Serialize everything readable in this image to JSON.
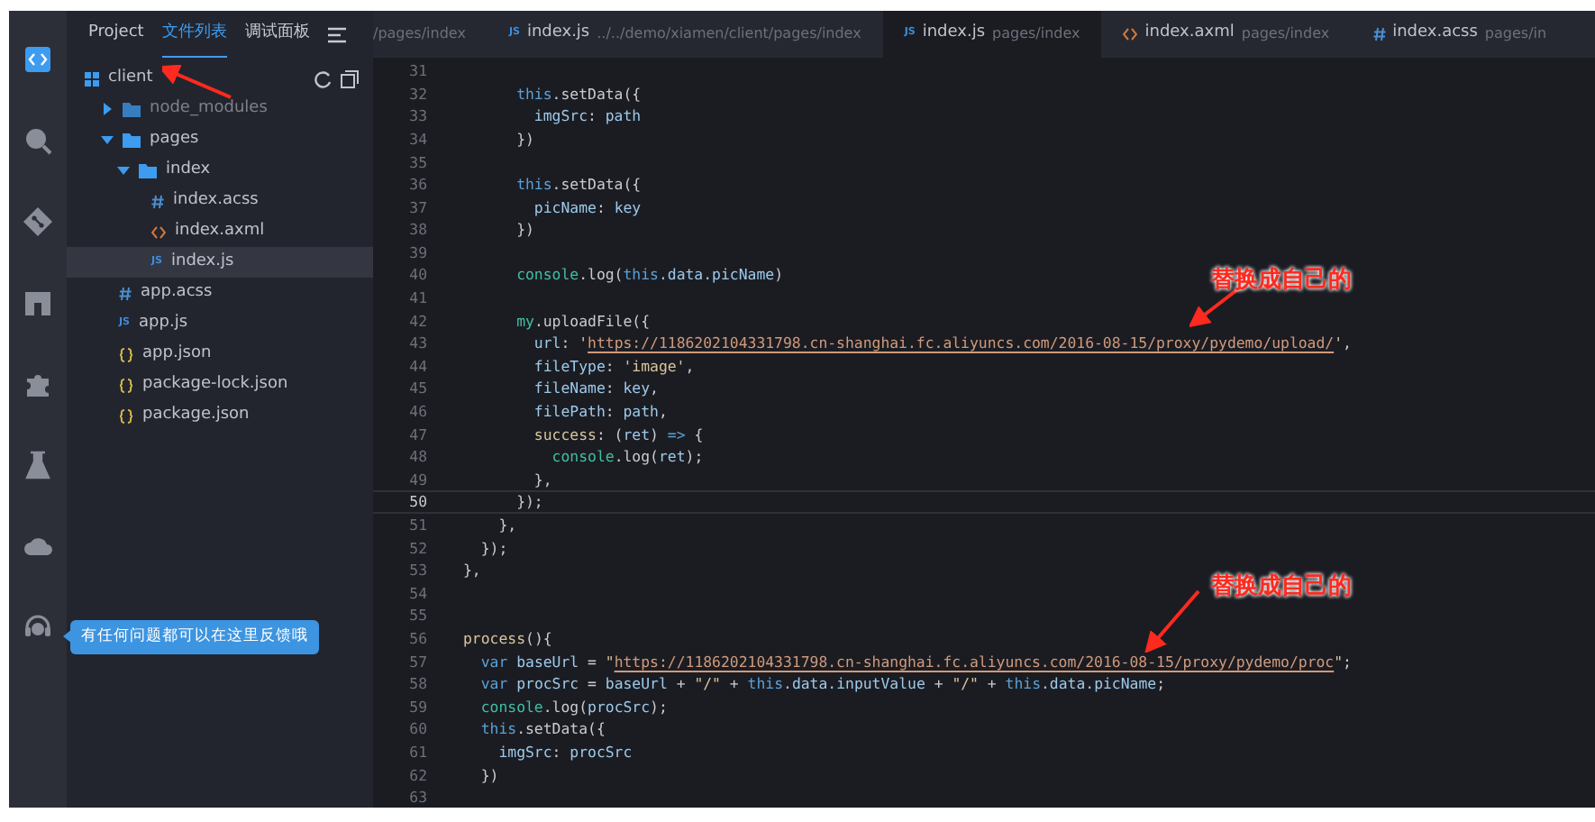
{
  "activity_bar": {
    "items": [
      {
        "kind": "code",
        "selected": true
      },
      {
        "kind": "search",
        "selected": false
      },
      {
        "kind": "git",
        "selected": false
      },
      {
        "kind": "store",
        "selected": false
      },
      {
        "kind": "plugin",
        "selected": false
      },
      {
        "kind": "flask",
        "selected": false
      },
      {
        "kind": "cloud",
        "selected": false
      },
      {
        "kind": "headset",
        "selected": false
      }
    ]
  },
  "sidebar": {
    "tabs": [
      {
        "label": "Project",
        "selected": false
      },
      {
        "label": "文件列表",
        "selected": true
      },
      {
        "label": "调试面板",
        "selected": false
      }
    ],
    "root": "client",
    "tree": [
      {
        "name": "node_modules",
        "kind": "folder",
        "expanded": false,
        "selected": false,
        "dim": true
      },
      {
        "name": "pages",
        "kind": "folder",
        "expanded": true,
        "selected": false,
        "dim": false,
        "children": [
          {
            "name": "index",
            "kind": "folder",
            "expanded": true,
            "selected": false,
            "dim": false,
            "children": [
              {
                "name": "index.acss",
                "kind": "acss",
                "selected": false,
                "dim": false
              },
              {
                "name": "index.axml",
                "kind": "axml",
                "selected": false,
                "dim": false
              },
              {
                "name": "index.js",
                "kind": "js",
                "icon_text": "JS",
                "selected": true,
                "dim": false
              }
            ]
          }
        ]
      },
      {
        "name": "app.acss",
        "kind": "acss",
        "selected": false,
        "dim": false
      },
      {
        "name": "app.js",
        "kind": "js",
        "icon_text": "JS",
        "selected": false,
        "dim": false
      },
      {
        "name": "app.json",
        "kind": "json",
        "selected": false,
        "dim": false
      },
      {
        "name": "package-lock.json",
        "kind": "json",
        "selected": false,
        "dim": false
      },
      {
        "name": "package.json",
        "kind": "json",
        "selected": false,
        "dim": false
      }
    ]
  },
  "tooltip": "有任何问题都可以在这里反馈哦",
  "editor_tabs": [
    {
      "kind": "none",
      "path": "/pages/index",
      "selected": false
    },
    {
      "kind": "js",
      "icon_text": "JS",
      "name": "index.js",
      "path": "../../demo/xiamen/client/pages/index",
      "selected": false
    },
    {
      "kind": "js",
      "icon_text": "JS",
      "name": "index.js",
      "path": "pages/index",
      "selected": true
    },
    {
      "kind": "axml",
      "name": "index.axml",
      "path": "pages/index",
      "selected": false
    },
    {
      "kind": "acss",
      "name": "index.acss",
      "path": "pages/in",
      "selected": false
    }
  ],
  "code": [
    {
      "number": "31",
      "current": false
    },
    {
      "number": "32",
      "current": false,
      "tokens": [
        {
          "kind": "this",
          "text": "      this"
        },
        {
          "kind": "plain",
          "text": ".setData({"
        }
      ]
    },
    {
      "number": "33",
      "current": false,
      "tokens": [
        {
          "kind": "prop",
          "text": "        imgSrc"
        },
        {
          "kind": "plain",
          "text": ": "
        },
        {
          "kind": "prop",
          "text": "path"
        }
      ]
    },
    {
      "number": "34",
      "current": false,
      "tokens": [
        {
          "kind": "plain",
          "text": "      })"
        }
      ]
    },
    {
      "number": "35",
      "current": false
    },
    {
      "number": "36",
      "current": false,
      "tokens": [
        {
          "kind": "this",
          "text": "      this"
        },
        {
          "kind": "plain",
          "text": ".setData({"
        }
      ]
    },
    {
      "number": "37",
      "current": false,
      "tokens": [
        {
          "kind": "prop",
          "text": "        picName"
        },
        {
          "kind": "plain",
          "text": ": "
        },
        {
          "kind": "prop",
          "text": "key"
        }
      ]
    },
    {
      "number": "38",
      "current": false,
      "tokens": [
        {
          "kind": "plain",
          "text": "      })"
        }
      ]
    },
    {
      "number": "39",
      "current": false
    },
    {
      "number": "40",
      "current": false,
      "tokens": [
        {
          "kind": "func",
          "text": "      console"
        },
        {
          "kind": "plain",
          "text": ".log("
        },
        {
          "kind": "this",
          "text": "this"
        },
        {
          "kind": "prop",
          "text": ".data.picName"
        },
        {
          "kind": "plain",
          "text": ")"
        }
      ]
    },
    {
      "number": "41",
      "current": false
    },
    {
      "number": "42",
      "current": false,
      "tokens": [
        {
          "kind": "func",
          "text": "      my"
        },
        {
          "kind": "plain",
          "text": ".uploadFile({"
        }
      ]
    },
    {
      "number": "43",
      "current": false,
      "tokens": [
        {
          "kind": "prop",
          "text": "        url"
        },
        {
          "kind": "plain",
          "text": ": "
        },
        {
          "kind": "string",
          "text": "'"
        },
        {
          "kind": "url",
          "text": "https://1186202104331798.cn-shanghai.fc.aliyuncs.com/2016-08-15/proxy/pydemo/upload/"
        },
        {
          "kind": "string",
          "text": "'"
        },
        {
          "kind": "plain",
          "text": ","
        }
      ]
    },
    {
      "number": "44",
      "current": false,
      "tokens": [
        {
          "kind": "prop",
          "text": "        fileType"
        },
        {
          "kind": "plain",
          "text": ": "
        },
        {
          "kind": "string",
          "text": "'image'"
        },
        {
          "kind": "plain",
          "text": ","
        }
      ]
    },
    {
      "number": "45",
      "current": false,
      "tokens": [
        {
          "kind": "prop",
          "text": "        fileName"
        },
        {
          "kind": "plain",
          "text": ": "
        },
        {
          "kind": "prop",
          "text": "key"
        },
        {
          "kind": "plain",
          "text": ","
        }
      ]
    },
    {
      "number": "46",
      "current": false,
      "tokens": [
        {
          "kind": "prop",
          "text": "        filePath"
        },
        {
          "kind": "plain",
          "text": ": "
        },
        {
          "kind": "prop",
          "text": "path"
        },
        {
          "kind": "plain",
          "text": ","
        }
      ]
    },
    {
      "number": "47",
      "current": false,
      "tokens": [
        {
          "kind": "string",
          "text": "        success"
        },
        {
          "kind": "plain",
          "text": ": ("
        },
        {
          "kind": "prop",
          "text": "ret"
        },
        {
          "kind": "plain",
          "text": ") "
        },
        {
          "kind": "keyword",
          "text": "=>"
        },
        {
          "kind": "plain",
          "text": " {"
        }
      ]
    },
    {
      "number": "48",
      "current": false,
      "tokens": [
        {
          "kind": "func",
          "text": "          console"
        },
        {
          "kind": "plain",
          "text": ".log("
        },
        {
          "kind": "prop",
          "text": "ret"
        },
        {
          "kind": "plain",
          "text": ");"
        }
      ]
    },
    {
      "number": "49",
      "current": false,
      "tokens": [
        {
          "kind": "plain",
          "text": "        },"
        }
      ]
    },
    {
      "number": "50",
      "current": true,
      "tokens": [
        {
          "kind": "plain",
          "text": "      });"
        }
      ]
    },
    {
      "number": "51",
      "current": false,
      "tokens": [
        {
          "kind": "plain",
          "text": "    },"
        }
      ]
    },
    {
      "number": "52",
      "current": false,
      "tokens": [
        {
          "kind": "plain",
          "text": "  });"
        }
      ]
    },
    {
      "number": "53",
      "current": false,
      "tokens": [
        {
          "kind": "plain",
          "text": "},"
        }
      ]
    },
    {
      "number": "54",
      "current": false
    },
    {
      "number": "55",
      "current": false
    },
    {
      "number": "56",
      "current": false,
      "tokens": [
        {
          "kind": "string",
          "text": "process"
        },
        {
          "kind": "plain",
          "text": "(){"
        }
      ]
    },
    {
      "number": "57",
      "current": false,
      "tokens": [
        {
          "kind": "keyword",
          "text": "  var"
        },
        {
          "kind": "prop",
          "text": " baseUrl"
        },
        {
          "kind": "plain",
          "text": " = "
        },
        {
          "kind": "string",
          "text": "\""
        },
        {
          "kind": "url",
          "text": "https://1186202104331798.cn-shanghai.fc.aliyuncs.com/2016-08-15/proxy/pydemo/proc"
        },
        {
          "kind": "string",
          "text": "\""
        },
        {
          "kind": "plain",
          "text": ";"
        }
      ]
    },
    {
      "number": "58",
      "current": false,
      "tokens": [
        {
          "kind": "keyword",
          "text": "  var"
        },
        {
          "kind": "prop",
          "text": " procSrc"
        },
        {
          "kind": "plain",
          "text": " = "
        },
        {
          "kind": "prop",
          "text": "baseUrl"
        },
        {
          "kind": "plain",
          "text": " + "
        },
        {
          "kind": "string",
          "text": "\"/\""
        },
        {
          "kind": "plain",
          "text": " + "
        },
        {
          "kind": "this",
          "text": "this"
        },
        {
          "kind": "prop",
          "text": ".data.inputValue"
        },
        {
          "kind": "plain",
          "text": " + "
        },
        {
          "kind": "string",
          "text": "\"/\""
        },
        {
          "kind": "plain",
          "text": " + "
        },
        {
          "kind": "this",
          "text": "this"
        },
        {
          "kind": "prop",
          "text": ".data.picName"
        },
        {
          "kind": "plain",
          "text": ";"
        }
      ]
    },
    {
      "number": "59",
      "current": false,
      "tokens": [
        {
          "kind": "func",
          "text": "  console"
        },
        {
          "kind": "plain",
          "text": ".log("
        },
        {
          "kind": "prop",
          "text": "procSrc"
        },
        {
          "kind": "plain",
          "text": ");"
        }
      ]
    },
    {
      "number": "60",
      "current": false,
      "tokens": [
        {
          "kind": "this",
          "text": "  this"
        },
        {
          "kind": "plain",
          "text": ".setData({"
        }
      ]
    },
    {
      "number": "61",
      "current": false,
      "tokens": [
        {
          "kind": "prop",
          "text": "    imgSrc"
        },
        {
          "kind": "plain",
          "text": ": "
        },
        {
          "kind": "prop",
          "text": "procSrc"
        }
      ]
    },
    {
      "number": "62",
      "current": false,
      "tokens": [
        {
          "kind": "plain",
          "text": "  })"
        }
      ]
    },
    {
      "number": "63",
      "current": false
    }
  ],
  "annotations": [
    {
      "text": "替换成自己的"
    },
    {
      "text": "替换成自己的"
    }
  ]
}
